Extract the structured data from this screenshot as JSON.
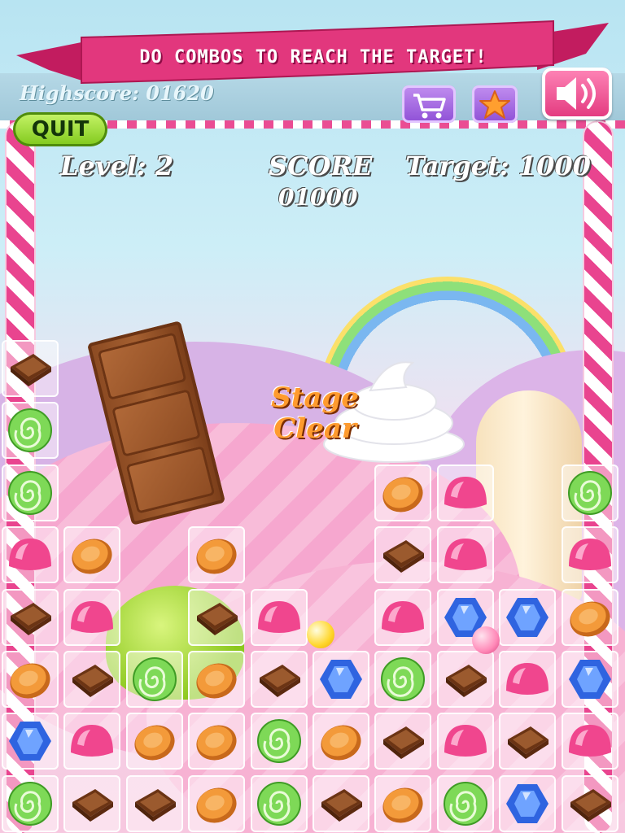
{
  "banner": {
    "text": "DO COMBOS TO REACH THE TARGET!"
  },
  "header": {
    "highscore": "Highscore: 01620",
    "cart_icon": "shopping-cart-icon",
    "star_icon": "star-icon",
    "sound_icon": "speaker-icon",
    "quit_label": "QUIT"
  },
  "hud": {
    "level": "Level: 2",
    "score_label": "SCORE",
    "score_value": "01000",
    "target": "Target: 1000"
  },
  "stage_message": {
    "line1": "Stage",
    "line2": "Clear"
  },
  "colors": {
    "banner": "#e2377d",
    "quit_button": "#8fd42a",
    "shop_buttons": "#a56ce3",
    "sound_button": "#f0559a",
    "candy_cane": "#e9448f"
  },
  "board": {
    "columns": 10,
    "rows": 8,
    "grid": [
      [
        "chocolate",
        "",
        "",
        "",
        "",
        "",
        "",
        "",
        "",
        ""
      ],
      [
        "swirl",
        "",
        "",
        "",
        "",
        "",
        "",
        "",
        "",
        ""
      ],
      [
        "swirl",
        "",
        "",
        "",
        "",
        "",
        "caramel",
        "gumdrop",
        "",
        "swirl"
      ],
      [
        "gumdrop",
        "caramel",
        "",
        "caramel",
        "",
        "",
        "chocolate",
        "gumdrop",
        "",
        "gumdrop"
      ],
      [
        "chocolate",
        "gumdrop",
        "",
        "chocolate",
        "gumdrop",
        "",
        "gumdrop",
        "gem",
        "gem",
        "caramel"
      ],
      [
        "caramel",
        "chocolate",
        "swirl",
        "caramel",
        "chocolate",
        "gem",
        "swirl",
        "chocolate",
        "gumdrop",
        "gem"
      ],
      [
        "gem",
        "gumdrop",
        "caramel",
        "caramel",
        "swirl",
        "caramel",
        "chocolate",
        "gumdrop",
        "chocolate",
        "gumdrop"
      ],
      [
        "swirl",
        "chocolate",
        "chocolate",
        "caramel",
        "swirl",
        "chocolate",
        "caramel",
        "swirl",
        "gem",
        "chocolate"
      ]
    ]
  }
}
